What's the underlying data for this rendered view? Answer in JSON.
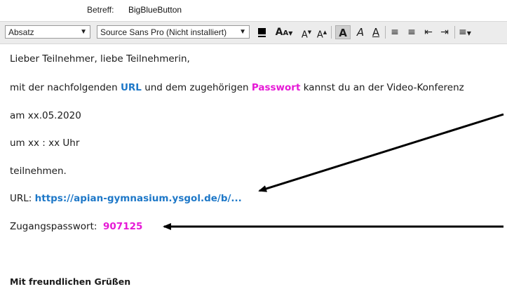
{
  "subject": {
    "label": "Betreff:",
    "value": "BigBlueButton"
  },
  "toolbar": {
    "paragraph_style": "Absatz",
    "font": "Source Sans Pro (Nicht installiert)",
    "icons": [
      "text-color-icon",
      "font-size-icon",
      "decrease-font-icon",
      "increase-font-icon",
      "bold-icon",
      "italic-icon",
      "underline-icon",
      "bullet-list-icon",
      "numbered-list-icon",
      "outdent-icon",
      "indent-icon",
      "align-icon"
    ]
  },
  "body": {
    "greeting": "Lieber Teilnehmer, liebe Teilnehmerin,",
    "intro_prefix": "mit der nachfolgenden ",
    "intro_url_word": "URL",
    "intro_middle": " und dem zugehörigen ",
    "intro_pw_word": "Passwort",
    "intro_suffix": " kannst du an der Video-Konferenz",
    "date": "am xx.05.2020",
    "time": "um xx : xx Uhr",
    "participate": "teilnehmen.",
    "url_label": "URL: ",
    "url_value": "https://apian-gymnasium.ysgol.de/b/...",
    "pw_label": "Zugangspasswort:",
    "pw_value": "907125",
    "signoff": "Mit freundlichen Grüßen"
  },
  "colors": {
    "url": "#1e78c8",
    "password": "#e619d6",
    "toolbar_bg": "#ececec"
  }
}
